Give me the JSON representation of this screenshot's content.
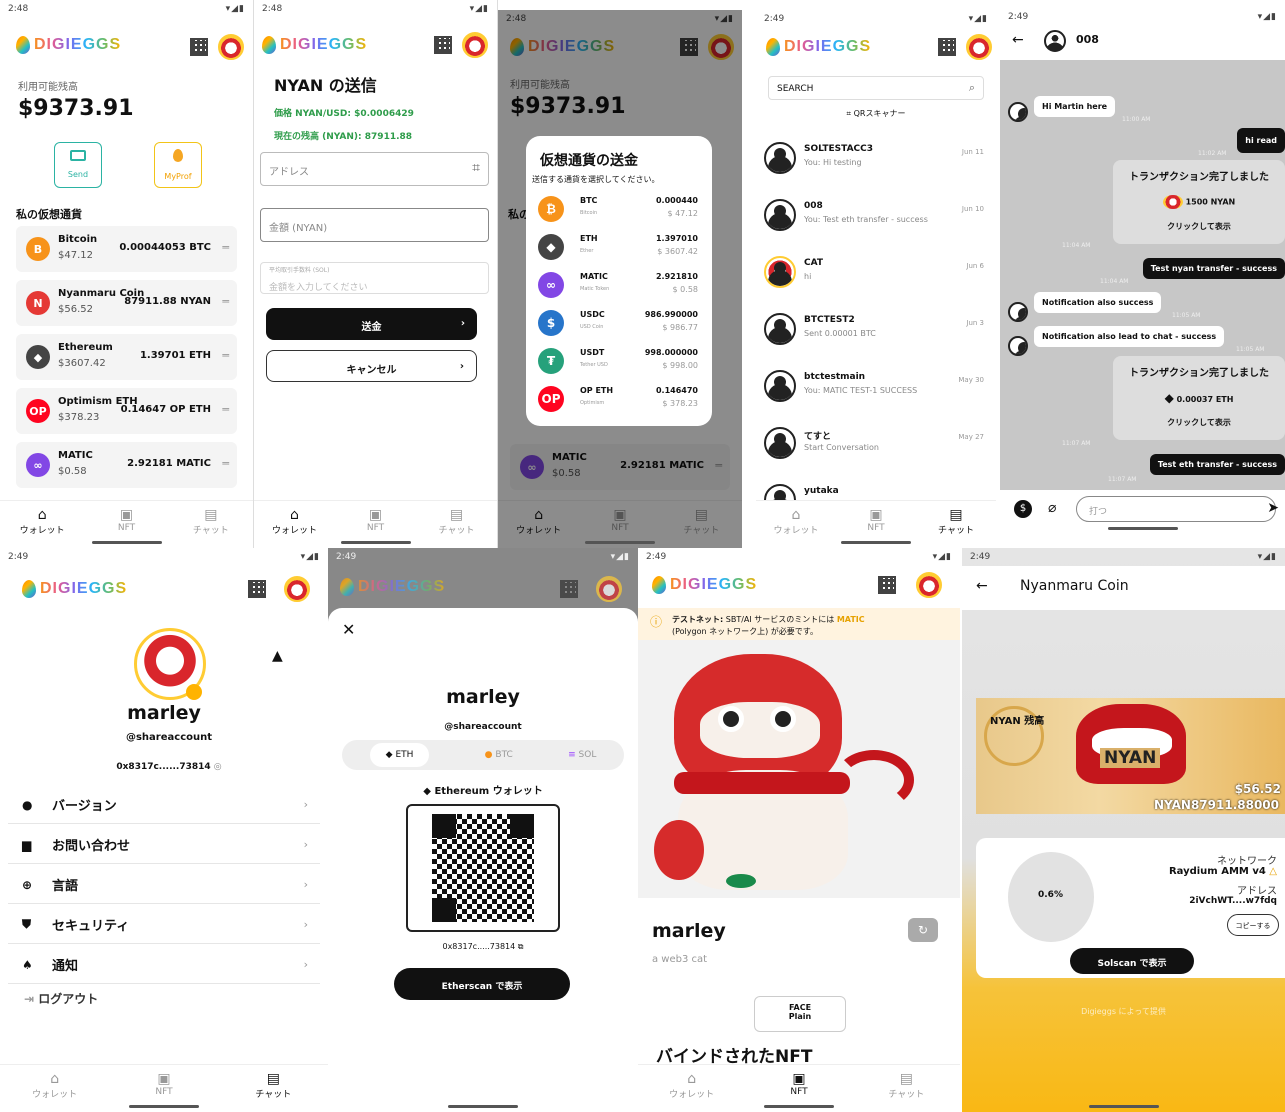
{
  "brand": "DIGIEGGS",
  "nav": {
    "wallet": "ウォレット",
    "nft": "NFT",
    "chat": "チャット"
  },
  "s1": {
    "time": "2:48",
    "balance_label": "利用可能残高",
    "balance": "$9373.91",
    "send": "Send",
    "myprof": "MyProf",
    "my_crypto": "私の仮想通貨",
    "coins": [
      {
        "name": "Bitcoin",
        "price": "$47.12",
        "balance": "0.00044053 BTC",
        "icon": "B",
        "color": "#f7931a"
      },
      {
        "name": "Nyanmaru Coin",
        "price": "$56.52",
        "balance": "87911.88 NYAN",
        "icon": "N",
        "color": "#e53935"
      },
      {
        "name": "Ethereum",
        "price": "$3607.42",
        "balance": "1.39701 ETH",
        "icon": "◆",
        "color": "#444"
      },
      {
        "name": "Optimism ETH",
        "price": "$378.23",
        "balance": "0.14647 OP ETH",
        "icon": "OP",
        "color": "#ff0420"
      },
      {
        "name": "MATIC",
        "price": "$0.58",
        "balance": "2.92181 MATIC",
        "icon": "∞",
        "color": "#8247e5"
      }
    ]
  },
  "s2": {
    "time": "2:48",
    "title": "NYAN の送信",
    "price": "価格 NYAN/USD: $0.0006429",
    "balance": "現在の残高 (NYAN): 87911.88",
    "address": "アドレス",
    "amount": "金額 (NYAN)",
    "fee_label": "平均取引手数料 (SOL)",
    "fee_placeholder": "金額を入力してください",
    "send": "送金",
    "cancel": "キャンセル"
  },
  "s3": {
    "time": "2:48",
    "balance_label": "利用可能残高",
    "balance": "$9373.91",
    "bg_label": "私の",
    "bg_coin": "MATIC",
    "bg_price": "$0.58",
    "bg_bal": "2.92181 MATIC",
    "modal_title": "仮想通貨の送金",
    "modal_sub": "送信する通貨を選択してください。",
    "coins": [
      {
        "sym": "BTC",
        "name": "Bitcoin",
        "amt": "0.000440",
        "usd": "$ 47.12",
        "icon": "₿",
        "color": "#f7931a"
      },
      {
        "sym": "ETH",
        "name": "Ether",
        "amt": "1.397010",
        "usd": "$ 3607.42",
        "icon": "◆",
        "color": "#444"
      },
      {
        "sym": "MATIC",
        "name": "Matic Token",
        "amt": "2.921810",
        "usd": "$ 0.58",
        "icon": "∞",
        "color": "#8247e5"
      },
      {
        "sym": "USDC",
        "name": "USD Coin",
        "amt": "986.990000",
        "usd": "$ 986.77",
        "icon": "$",
        "color": "#2775ca"
      },
      {
        "sym": "USDT",
        "name": "Tether USD",
        "amt": "998.000000",
        "usd": "$ 998.00",
        "icon": "₮",
        "color": "#26a17b"
      },
      {
        "sym": "OP ETH",
        "name": "Optimism",
        "amt": "0.146470",
        "usd": "$ 378.23",
        "icon": "OP",
        "color": "#ff0420"
      }
    ]
  },
  "s4": {
    "time": "2:49",
    "search": "SEARCH",
    "qr": "QRスキャナー",
    "chats": [
      {
        "name": "SOLTESTACC3",
        "preview": "You: Hi testing",
        "date": "Jun 11"
      },
      {
        "name": "008",
        "preview": "You: Test eth transfer - success",
        "date": "Jun 10"
      },
      {
        "name": "CAT",
        "preview": "hi",
        "date": "Jun 6"
      },
      {
        "name": "BTCTEST2",
        "preview": "Sent 0.00001 BTC",
        "date": "Jun 3"
      },
      {
        "name": "btctestmain",
        "preview": "You: MATIC TEST-1 SUCCESS",
        "date": "May 30"
      },
      {
        "name": "てすと",
        "preview": "Start Conversation",
        "date": "May 27"
      },
      {
        "name": "yutaka",
        "preview": "",
        "date": ""
      }
    ]
  },
  "s5": {
    "time": "2:49",
    "title": "008",
    "m1": "Hi Martin here",
    "t1": "11:00 AM",
    "m2": "hi read",
    "t2": "11:02 AM",
    "card1_title": "トランザクション完了しました",
    "card1_amt": "1500 NYAN",
    "card1_link": "クリックして表示",
    "t3": "11:04 AM",
    "m3": "Test nyan transfer - success",
    "t4": "11:04 AM",
    "m4": "Notification also success",
    "t5": "11:05 AM",
    "m5": "Notification also lead to chat - success",
    "t6": "11:05 AM",
    "card2_title": "トランザクション完了しました",
    "card2_amt": "0.00037 ETH",
    "card2_link": "クリックして表示",
    "t7": "11:07 AM",
    "m6": "Test eth transfer - success",
    "t8": "11:07 AM",
    "input": "打つ"
  },
  "s6": {
    "time": "2:49",
    "name": "marley",
    "handle": "@shareaccount",
    "address": "0x8317c......73814",
    "menu": [
      "バージョン",
      "お問い合わせ",
      "言語",
      "セキュリティ",
      "通知"
    ],
    "logout": "ログアウト"
  },
  "s7": {
    "time": "2:49",
    "name": "marley",
    "handle": "@shareaccount",
    "tabs": [
      "ETH",
      "BTC",
      "SOL"
    ],
    "wallet_label": "Ethereum ウォレット",
    "address": "0x8317c.....73814",
    "button": "Etherscan で表示"
  },
  "s8": {
    "time": "2:49",
    "notice_bold": "テストネット:",
    "notice": " SBT/AI サービスのミントには ",
    "notice_matic": "MATIC",
    "notice2": "(Polygon ネットワーク上) が必要です。",
    "name": "marley",
    "sub": "a web3 cat",
    "face_label": "FACE",
    "face_value": "Plain",
    "bound": "バインドされたNFT"
  },
  "s9": {
    "time": "2:49",
    "title": "Nyanmaru Coin",
    "balance_label": "NYAN 残高",
    "banner": "NYAN",
    "usd": "$56.52",
    "nyan": "NYAN87911.88000",
    "pct": "0.6%",
    "network_label": "ネットワーク",
    "network": "Raydium AMM v4",
    "addr_label": "アドレス",
    "addr": "2iVchWT....w7fdq",
    "copy": "コピーする",
    "solscan": "Solscan で表示",
    "footer": "Digieggs によって提供"
  }
}
